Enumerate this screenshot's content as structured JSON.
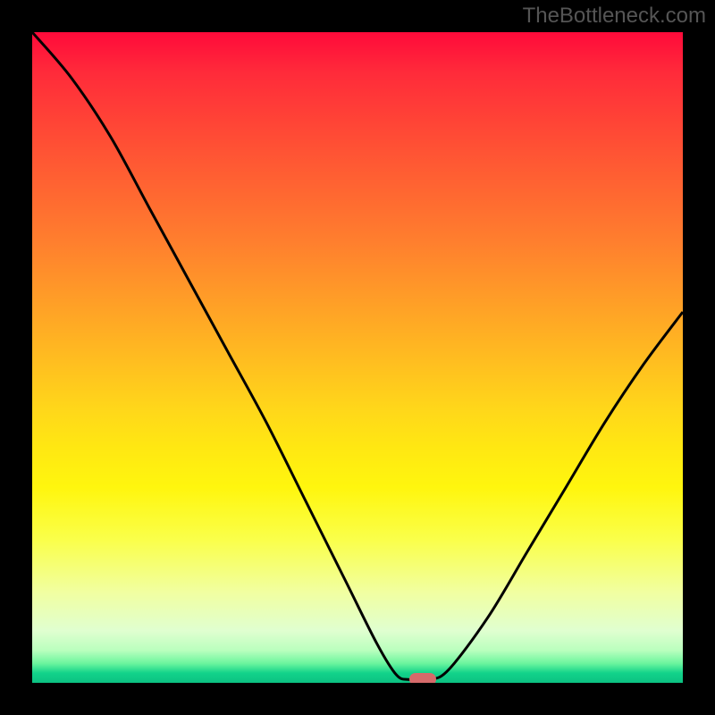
{
  "watermark": "TheBottleneck.com",
  "chart_data": {
    "type": "line",
    "title": "",
    "xlabel": "",
    "ylabel": "",
    "xlim": [
      0,
      100
    ],
    "ylim": [
      0,
      100
    ],
    "grid": false,
    "curve_points": [
      {
        "x": 0,
        "y": 100
      },
      {
        "x": 6,
        "y": 93
      },
      {
        "x": 12,
        "y": 84
      },
      {
        "x": 18,
        "y": 73
      },
      {
        "x": 24,
        "y": 62
      },
      {
        "x": 30,
        "y": 51
      },
      {
        "x": 36,
        "y": 40
      },
      {
        "x": 42,
        "y": 28
      },
      {
        "x": 48,
        "y": 16
      },
      {
        "x": 53,
        "y": 6
      },
      {
        "x": 56,
        "y": 1.2
      },
      {
        "x": 58,
        "y": 0.5
      },
      {
        "x": 61,
        "y": 0.5
      },
      {
        "x": 64,
        "y": 2
      },
      {
        "x": 70,
        "y": 10
      },
      {
        "x": 76,
        "y": 20
      },
      {
        "x": 82,
        "y": 30
      },
      {
        "x": 88,
        "y": 40
      },
      {
        "x": 94,
        "y": 49
      },
      {
        "x": 100,
        "y": 57
      }
    ],
    "marker": {
      "x": 60,
      "y": 0.5,
      "color": "#d66a6a"
    },
    "background": {
      "type": "gradient",
      "stops": [
        {
          "pos": 0,
          "color": "#ff0a3a"
        },
        {
          "pos": 50,
          "color": "#ffb522"
        },
        {
          "pos": 70,
          "color": "#fff60e"
        },
        {
          "pos": 98,
          "color": "#12d38a"
        },
        {
          "pos": 100,
          "color": "#0cc182"
        }
      ]
    }
  }
}
